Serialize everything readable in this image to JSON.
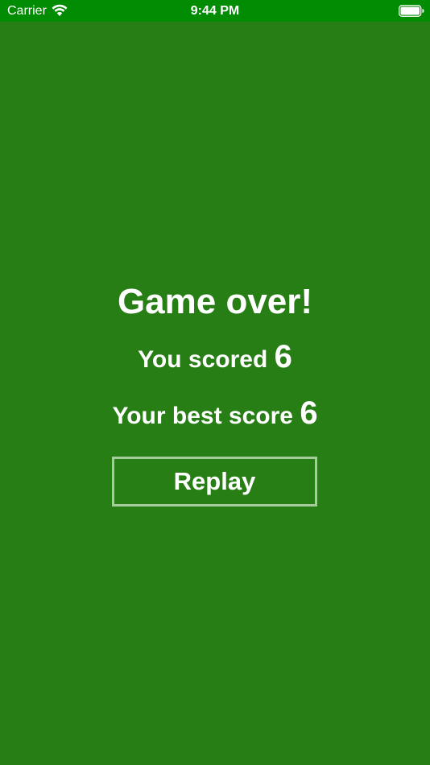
{
  "status_bar": {
    "carrier": "Carrier",
    "time": "9:44 PM",
    "wifi_icon": "wifi-icon",
    "battery_icon": "battery-icon"
  },
  "game_over": {
    "title": "Game over!",
    "scored_label": "You scored",
    "scored_value": "6",
    "best_label": "Your best score",
    "best_value": "6",
    "replay_label": "Replay"
  },
  "colors": {
    "background": "#267e14",
    "status_bar": "#028c04",
    "button_border": "#a6cb9c",
    "text": "#ffffff"
  }
}
